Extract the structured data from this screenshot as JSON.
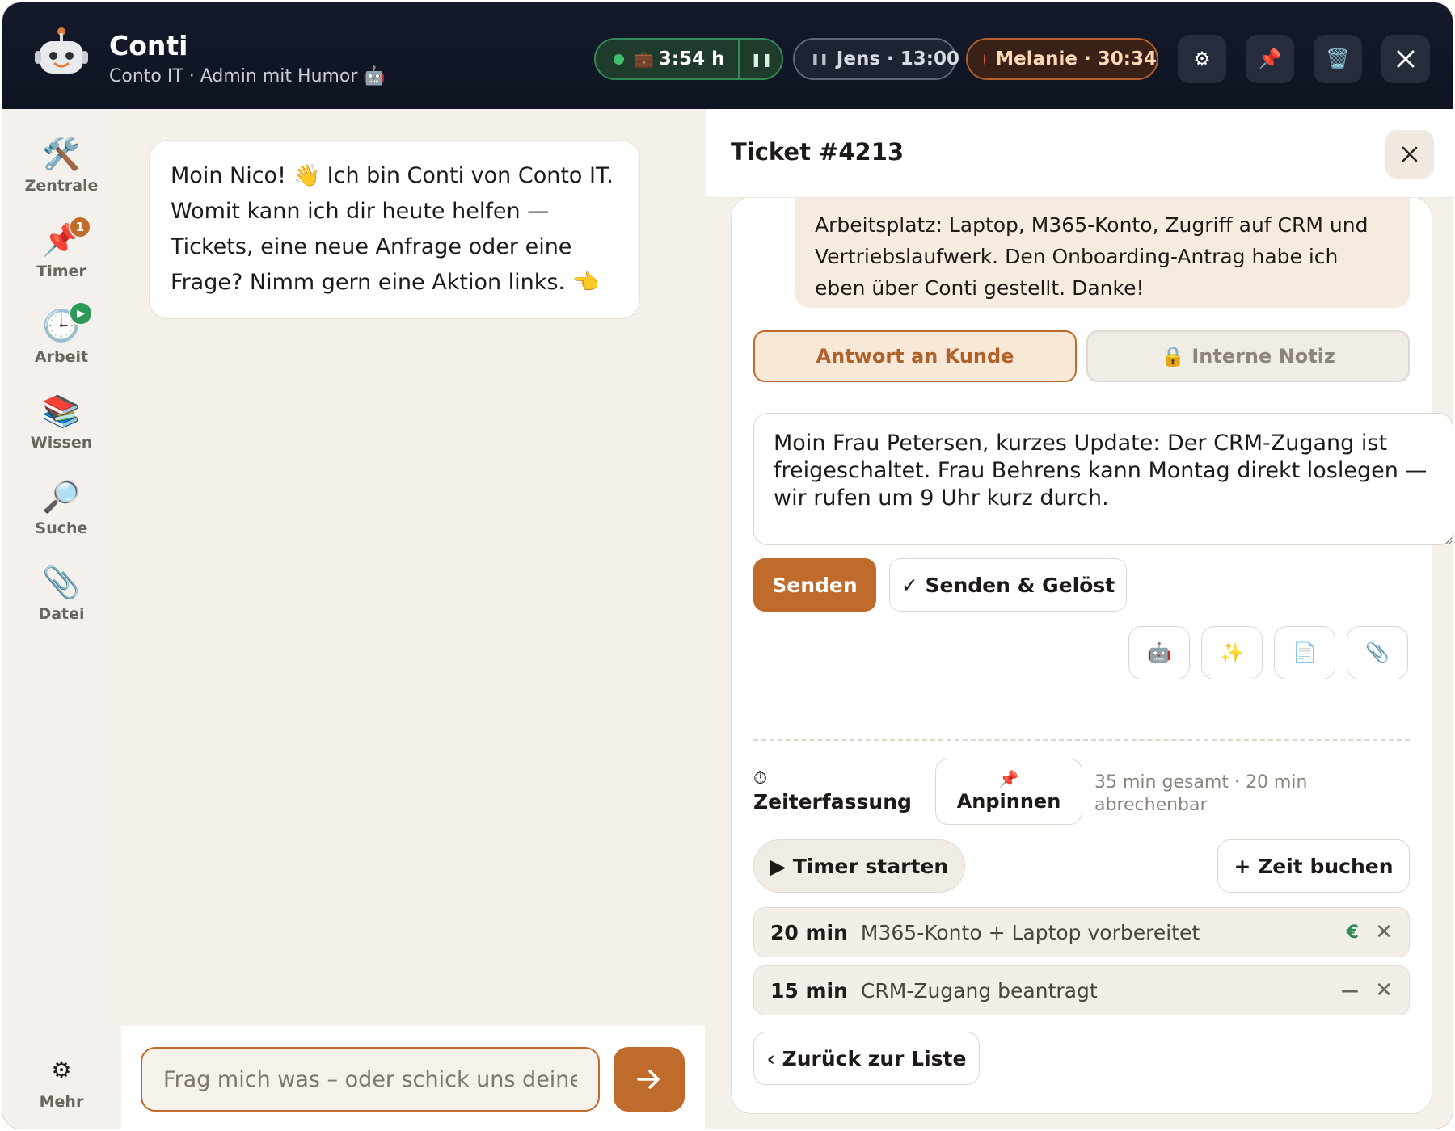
{
  "header": {
    "title": "Conti",
    "subtitle": "Conto IT · Admin mit Humor 🤖",
    "work_timer": "3:54 h",
    "timer_jens": "Jens · 13:00",
    "timer_melanie": "Melanie · 30:34"
  },
  "sidebar": {
    "items": [
      {
        "label": "Zentrale",
        "icon": "🛠️"
      },
      {
        "label": "Timer",
        "icon": "📌",
        "badge": "1"
      },
      {
        "label": "Arbeit",
        "icon": "🕒"
      },
      {
        "label": "Wissen",
        "icon": "📚"
      },
      {
        "label": "Suche",
        "icon": "🔎"
      },
      {
        "label": "Datei",
        "icon": "📎"
      },
      {
        "label": "Mehr",
        "icon": "⚙"
      }
    ]
  },
  "chat": {
    "greeting": "Moin Nico! 👋 Ich bin Conti von Conto IT. Womit kann ich dir heute helfen — Tickets, eine neue Anfrage oder eine Frage? Nimm gern eine Aktion links. 👈",
    "input_placeholder": "Frag mich was – oder schick uns deine"
  },
  "ticket": {
    "title": "Ticket #4213",
    "message": "Arbeitsplatz: Laptop, M365-Konto, Zugriff auf CRM und Vertriebslaufwerk. Den Onboarding-Antrag habe ich eben über Conti gestellt. Danke!",
    "tab_reply": "Antwort an Kunde",
    "tab_note": "🔒 Interne Notiz",
    "reply_text": "Moin Frau Petersen, kurzes Update: Der CRM-Zugang ist freigeschaltet. Frau Behrens kann Montag direkt loslegen — wir rufen um 9 Uhr kurz durch.",
    "send_label": "Senden",
    "send_solved_label": "✓ Senden & Gelöst",
    "tools": [
      "🤖",
      "✨",
      "📄",
      "📎"
    ],
    "time_tracking": {
      "label": "Zeiterfassung",
      "pin_label": "Anpinnen",
      "summary": "35 min gesamt · 20 min abrechenbar",
      "start_timer_label": "▶ Timer starten",
      "book_time_label": "+ Zeit buchen",
      "entries": [
        {
          "duration": "20 min",
          "description": "M365-Konto + Laptop vorbereitet",
          "billing": "€",
          "billing_color": "#2e8b57"
        },
        {
          "duration": "15 min",
          "description": "CRM-Zugang beantragt",
          "billing": "—",
          "billing_color": "#6b6560"
        }
      ]
    },
    "back_label": "‹ Zurück zur Liste"
  }
}
